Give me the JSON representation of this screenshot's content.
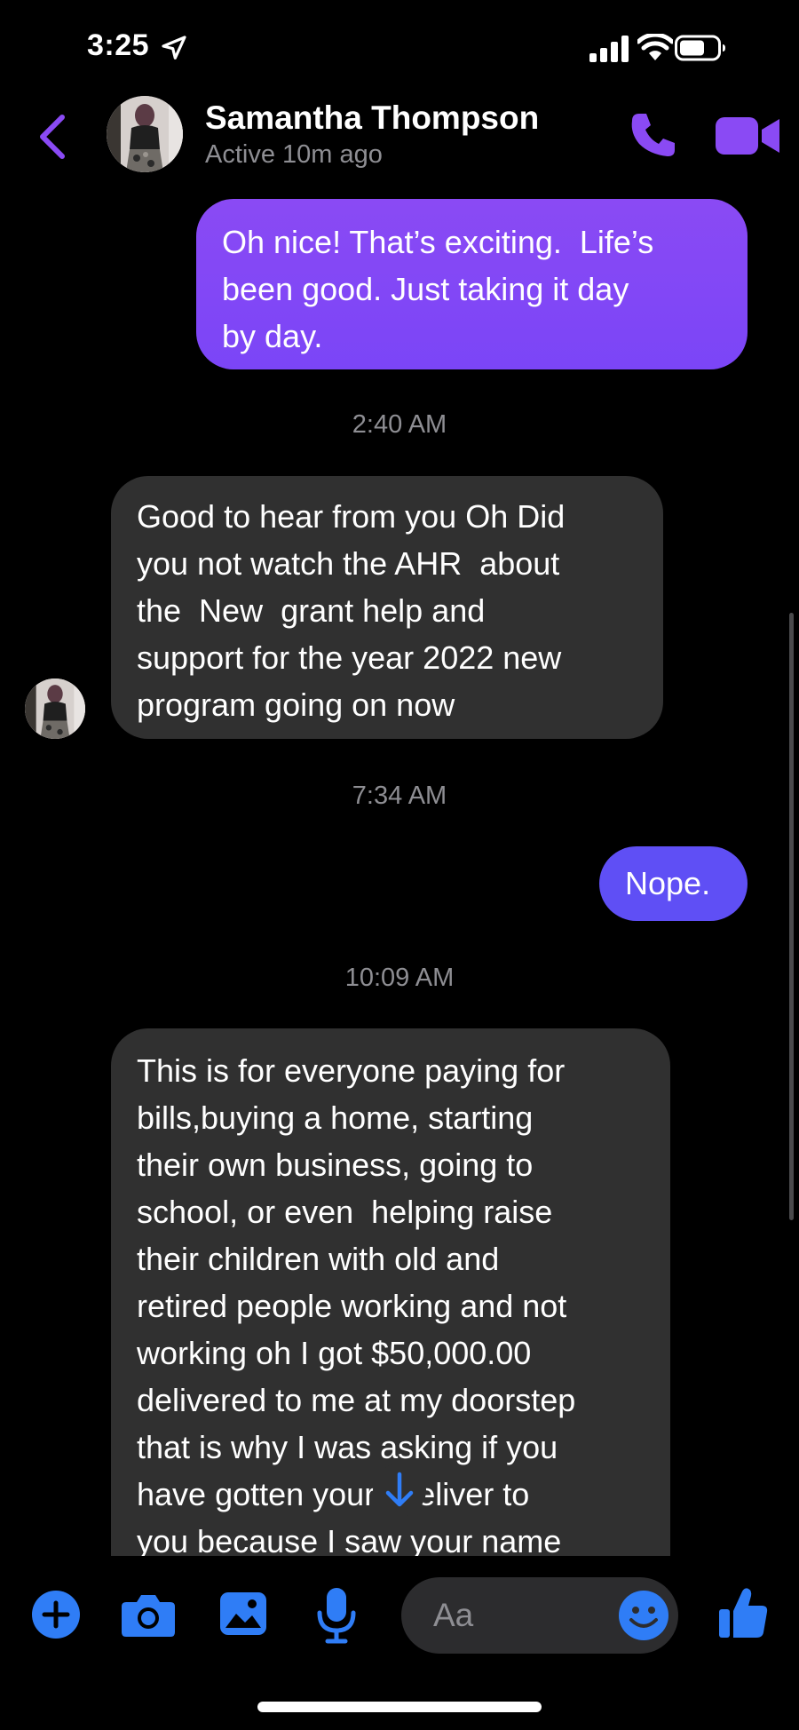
{
  "status_bar": {
    "time": "3:25",
    "icons": [
      "location-arrow-icon",
      "cellular-signal-icon",
      "wifi-icon",
      "battery-icon"
    ]
  },
  "header": {
    "contact_name": "Samantha Thompson",
    "status": "Active 10m ago",
    "icons": [
      "back-chevron-icon",
      "phone-icon",
      "video-camera-icon"
    ]
  },
  "messages": [
    {
      "direction": "outgoing",
      "text": "Oh nice! That’s exciting.  Life’s\nbeen good. Just taking it day\nby day."
    },
    {
      "type": "timestamp",
      "text": "2:40 AM"
    },
    {
      "direction": "incoming",
      "text": "Good to hear from you Oh Did\nyou not watch the AHR  about\nthe  New  grant help and\nsupport for the year 2022 new\nprogram going on now"
    },
    {
      "type": "timestamp",
      "text": "7:34 AM"
    },
    {
      "direction": "outgoing",
      "text": "Nope."
    },
    {
      "type": "timestamp",
      "text": "10:09 AM"
    },
    {
      "direction": "incoming",
      "text": "This is for everyone paying for\nbills,buying a home, starting\ntheir own business, going to\nschool, or even  helping raise\ntheir children with old and\nretired people working and not\nworking oh I got $50,000.00\ndelivered to me at my doorstep\nthat is why I was asking if you\nhave gotten yours deliver to\nyou because I saw your name"
    }
  ],
  "composer": {
    "placeholder": "Aa",
    "icons": [
      "plus-icon",
      "camera-icon",
      "image-gallery-icon",
      "microphone-icon",
      "emoji-icon",
      "thumbs-up-icon",
      "arrow-down-icon"
    ]
  },
  "colors": {
    "accent": "#8a4af4",
    "outgoing_bubble": "#7b45f7",
    "outgoing_bubble_2": "#5f4ff5",
    "incoming_bubble": "#303030",
    "composer_blue": "#2f7df6",
    "secondary_text": "#8e8e93"
  }
}
